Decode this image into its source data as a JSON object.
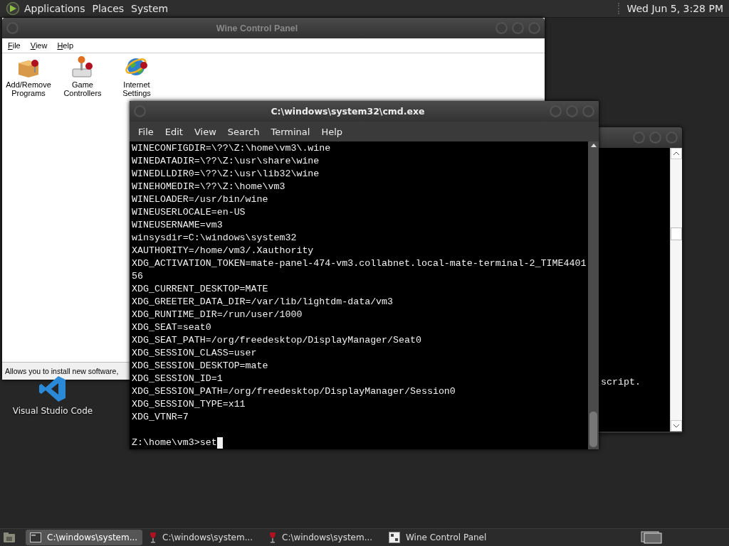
{
  "top_panel": {
    "menus": [
      "Applications",
      "Places",
      "System"
    ],
    "clock": "Wed Jun  5, 3:28 PM"
  },
  "control_panel": {
    "title": "Wine Control Panel",
    "menus": [
      "File",
      "View",
      "Help"
    ],
    "applets": [
      {
        "label": "Add/Remove Programs",
        "kind": "box"
      },
      {
        "label": "Game Controllers",
        "kind": "joystick"
      },
      {
        "label": "Internet Settings",
        "kind": "globe"
      }
    ],
    "status": "Allows you to install new software,"
  },
  "desktop_icons": [
    {
      "label": "Visual Studio Code"
    }
  ],
  "back_window": {
    "text": "script."
  },
  "terminal": {
    "title": "C:\\windows\\system32\\cmd.exe",
    "menus": [
      "File",
      "Edit",
      "View",
      "Search",
      "Terminal",
      "Help"
    ],
    "lines": [
      "WINECONFIGDIR=\\??\\Z:\\home\\vm3\\.wine",
      "WINEDATADIR=\\??\\Z:\\usr\\share\\wine",
      "WINEDLLDIR0=\\??\\Z:\\usr\\lib32\\wine",
      "WINEHOMEDIR=\\??\\Z:\\home\\vm3",
      "WINELOADER=/usr/bin/wine",
      "WINEUSERLOCALE=en-US",
      "WINEUSERNAME=vm3",
      "winsysdir=C:\\windows\\system32",
      "XAUTHORITY=/home/vm3/.Xauthority",
      "XDG_ACTIVATION_TOKEN=mate-panel-474-vm3.collabnet.local-mate-terminal-2_TIME4401",
      "56",
      "XDG_CURRENT_DESKTOP=MATE",
      "XDG_GREETER_DATA_DIR=/var/lib/lightdm-data/vm3",
      "XDG_RUNTIME_DIR=/run/user/1000",
      "XDG_SEAT=seat0",
      "XDG_SEAT_PATH=/org/freedesktop/DisplayManager/Seat0",
      "XDG_SESSION_CLASS=user",
      "XDG_SESSION_DESKTOP=mate",
      "XDG_SESSION_ID=1",
      "XDG_SESSION_PATH=/org/freedesktop/DisplayManager/Session0",
      "XDG_SESSION_TYPE=x11",
      "XDG_VTNR=7"
    ],
    "prompt": "Z:\\home\\vm3>set"
  },
  "taskbar": {
    "tasks": [
      {
        "label": "C:\\windows\\system...",
        "kind": "terminal",
        "selected": true
      },
      {
        "label": "C:\\windows\\system...",
        "kind": "wine",
        "selected": false
      },
      {
        "label": "C:\\windows\\system...",
        "kind": "wine",
        "selected": false
      },
      {
        "label": "Wine Control Panel",
        "kind": "panel",
        "selected": false
      }
    ]
  }
}
